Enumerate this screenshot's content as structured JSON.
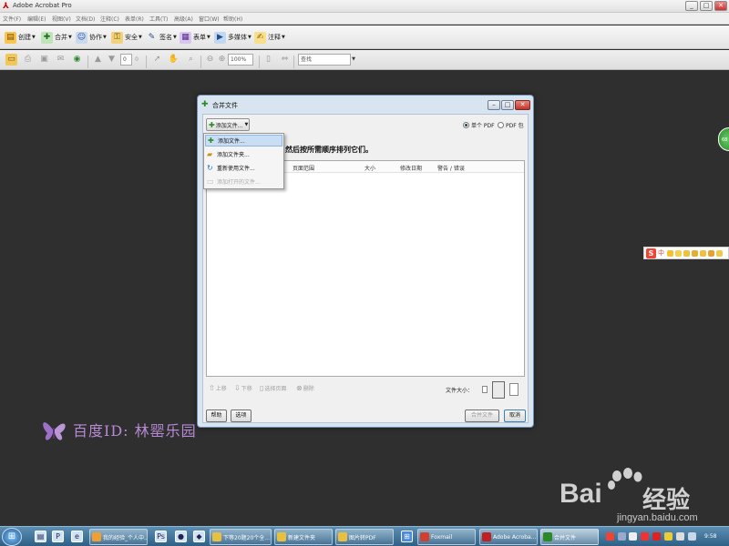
{
  "window": {
    "title": "Adobe Acrobat Pro",
    "controls": {
      "minimize": "_",
      "maximize": "□",
      "close": "✕"
    }
  },
  "menubar": {
    "items": [
      "文件(F)",
      "编辑(E)",
      "视图(V)",
      "文档(D)",
      "注释(C)",
      "表单(R)",
      "工具(T)",
      "高级(A)",
      "窗口(W)",
      "帮助(H)"
    ]
  },
  "toolbar1": {
    "items": [
      {
        "label": "创建",
        "icon": "create-icon",
        "color": "#e8a010"
      },
      {
        "label": "合并",
        "icon": "merge-icon",
        "color": "#2a8a2a"
      },
      {
        "label": "协作",
        "icon": "collaborate-icon",
        "color": "#3a6fb0"
      },
      {
        "label": "安全",
        "icon": "lock-icon",
        "color": "#c89018"
      },
      {
        "label": "签名",
        "icon": "pen-icon",
        "color": "#3a6fb0"
      },
      {
        "label": "表单",
        "icon": "form-icon",
        "color": "#7a4aa8"
      },
      {
        "label": "多媒体",
        "icon": "multimedia-icon",
        "color": "#2a70c0"
      },
      {
        "label": "注释",
        "icon": "comment-icon",
        "color": "#d8a020"
      }
    ]
  },
  "toolbar2": {
    "page_number": "0",
    "page_total": "0",
    "zoom": "100%",
    "search_placeholder": "查找"
  },
  "dialog": {
    "title": "合并文件",
    "add_files_label": "添加文件...",
    "radio_single": "单个 PDF",
    "radio_package": "PDF 包",
    "instruction": "然后按所需顺序排列它们。",
    "columns": [
      "页面范围",
      "大小",
      "修改日期",
      "警告 / 错误"
    ],
    "move_up": "上移",
    "move_down": "下移",
    "choose_pages": "选择页面",
    "delete": "删除",
    "file_size_label": "文件大小：",
    "help_button": "帮助",
    "options_button": "选项",
    "merge_button": "合并文件",
    "cancel_button": "取消"
  },
  "dropdown": {
    "items": [
      {
        "label": "添加文件...",
        "icon": "add-file-icon",
        "state": "selected"
      },
      {
        "label": "添加文件夹...",
        "icon": "add-folder-icon",
        "state": "normal"
      },
      {
        "label": "重新使用文件...",
        "icon": "reuse-icon",
        "state": "normal"
      },
      {
        "label": "添加打开的文件...",
        "icon": "add-open-icon",
        "state": "disabled"
      }
    ]
  },
  "side": {
    "badge_text": "68",
    "ime_label": "中"
  },
  "watermark": {
    "text": "百度ID: 林罂乐园",
    "baidu_brand": "Bai",
    "baidu_jingyan": "经验",
    "baidu_url": "jingyan.baidu.com"
  },
  "taskbar": {
    "tasks": [
      {
        "label": "我的经验_个人中...",
        "color": "#f0a030"
      },
      {
        "label": "下等20题20个全...",
        "color": "#e8c040"
      },
      {
        "label": "新建文件夹",
        "color": "#e8c040"
      },
      {
        "label": "图片转PDF",
        "color": "#e8c040"
      },
      {
        "label": "Foxmail",
        "color": "#d04030"
      },
      {
        "label": "Adobe Acroba...",
        "color": "#c02020"
      },
      {
        "label": "合并文件",
        "color": "#2a8a2a"
      }
    ],
    "clock": "9:58"
  }
}
